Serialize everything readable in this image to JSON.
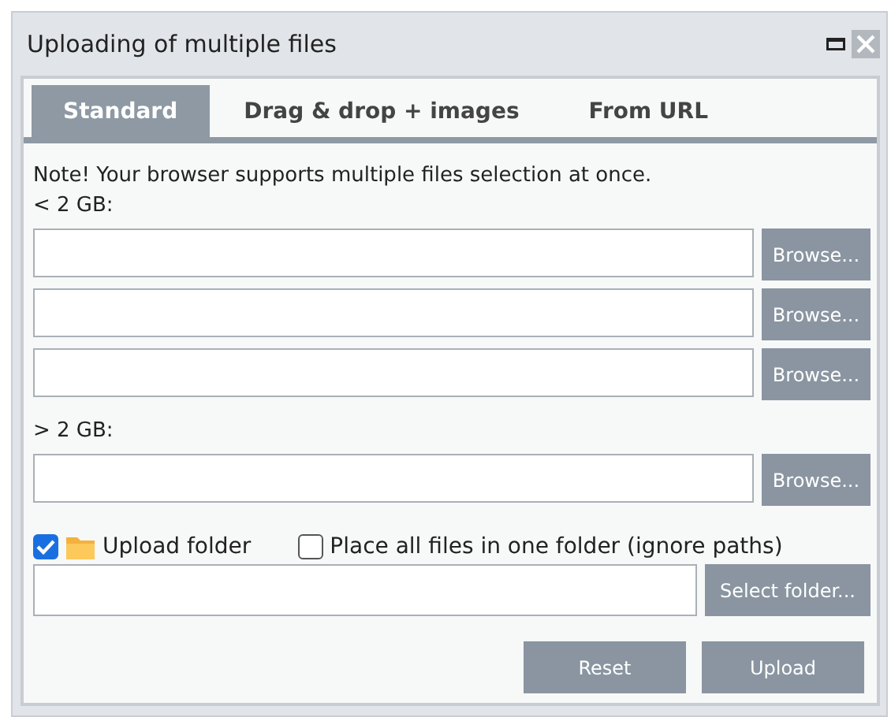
{
  "window": {
    "title": "Uploading of multiple files"
  },
  "tabs": [
    {
      "label": "Standard",
      "selected": true
    },
    {
      "label": "Drag & drop + images",
      "selected": false
    },
    {
      "label": "From URL",
      "selected": false
    }
  ],
  "note": "Note! Your browser supports multiple files selection at once.",
  "rows": [
    {
      "kind": "label",
      "text": "< 2 GB:"
    },
    {
      "kind": "file",
      "button": "Browse..."
    },
    {
      "kind": "file",
      "button": "Browse..."
    },
    {
      "kind": "file",
      "button": "Browse..."
    },
    {
      "kind": "label",
      "text": "> 2 GB:"
    },
    {
      "kind": "file",
      "button": "Browse..."
    }
  ],
  "options": [
    {
      "kind": "folder",
      "label": "Upload folder",
      "checked": true
    },
    {
      "kind": "plain",
      "label": "Place all files in one folder (ignore paths)",
      "checked": false
    }
  ],
  "folder_button": "Select folder...",
  "buttons": [
    "Reset",
    "Upload"
  ]
}
